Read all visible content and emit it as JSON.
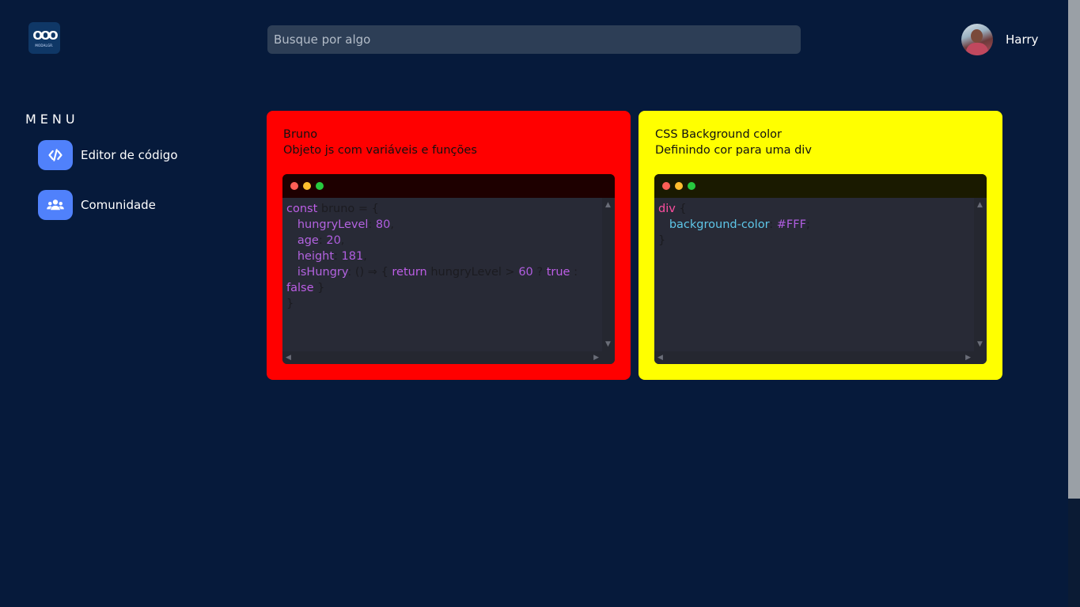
{
  "header": {
    "logo_mark": "OOO",
    "logo_text": "MODALGR.",
    "search_placeholder": "Busque por algo",
    "username": "Harry"
  },
  "menu": {
    "title": "MENU",
    "items": [
      {
        "label": "Editor de código",
        "icon": "code-icon"
      },
      {
        "label": "Comunidade",
        "icon": "users-icon"
      }
    ]
  },
  "cards": [
    {
      "title": "Bruno",
      "description": "Objeto js com variáveis e funções",
      "background": "#ff0000",
      "toolbar_color": "#1e0000",
      "code": {
        "l1_kw": "const",
        "l1_rest": " bruno = {",
        "l2_prop": "hungryLevel",
        "l2_num": "80",
        "l3_prop": "age",
        "l3_num": "20",
        "l4_prop": "height",
        "l4_num": "181",
        "l5_prop": "isHungry",
        "l5_mid": ": () ⇒ { ",
        "l5_kw": "return",
        "l5_var": " hungryLevel > ",
        "l5_num": "60",
        "l5_q": " ? ",
        "l5_true": "true",
        "l5_colon": " :",
        "l6_false": "false",
        "l6_close": " }",
        "l7_close": "}"
      }
    },
    {
      "title": "CSS Background color",
      "description": "Definindo cor para uma div",
      "background": "#ffff00",
      "toolbar_color": "#1a1a00",
      "code": {
        "l1_tag": "div",
        "l1_rest": " {",
        "l2_attr": "background-color",
        "l2_val": "#FFF",
        "l3_close": "}"
      }
    }
  ],
  "colors": {
    "page_bg": "#061a3b",
    "accent": "#5081fb",
    "dot_red": "#ff5f56",
    "dot_yellow": "#ffbd2e",
    "dot_green": "#27c93f"
  }
}
